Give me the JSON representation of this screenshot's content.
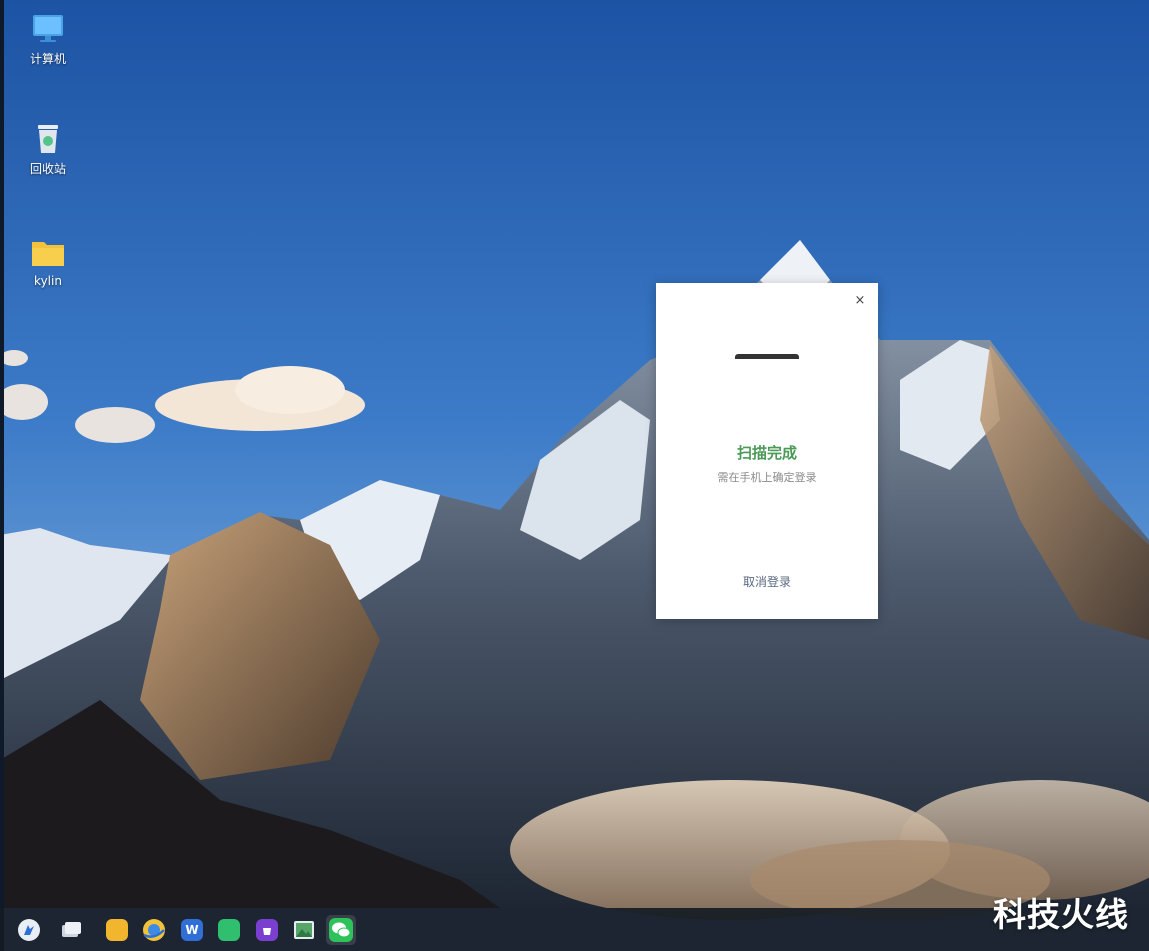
{
  "desktop": {
    "icons": [
      {
        "label": "计算机",
        "icon": "computer-icon"
      },
      {
        "label": "回收站",
        "icon": "trash-icon"
      },
      {
        "label": "kylin",
        "icon": "folder-icon"
      }
    ]
  },
  "dialog": {
    "close_glyph": "×",
    "title": "扫描完成",
    "subtitle": "需在手机上确定登录",
    "cancel_label": "取消登录",
    "title_color": "#4a9a56"
  },
  "taskbar": {
    "icons": [
      {
        "name": "start-menu-icon"
      },
      {
        "name": "multitask-view-icon"
      },
      {
        "name": "file-manager-icon"
      },
      {
        "name": "browser-icon"
      },
      {
        "name": "wps-icon",
        "glyph": "W"
      },
      {
        "name": "message-app-icon"
      },
      {
        "name": "software-store-icon"
      },
      {
        "name": "image-viewer-icon"
      },
      {
        "name": "wechat-icon"
      }
    ]
  },
  "watermark": "科技火线"
}
